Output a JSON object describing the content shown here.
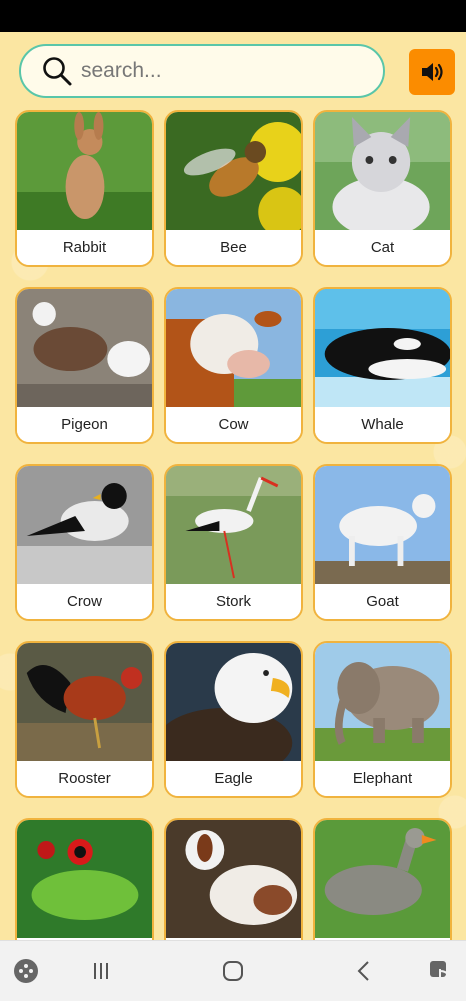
{
  "search": {
    "placeholder": "search..."
  },
  "colors": {
    "accent": "#59c6a9",
    "sound_button": "#fb8c00",
    "card_border": "#f0b33e",
    "background": "#fbe6a2"
  },
  "icons": {
    "search": "search-icon",
    "sound": "speaker-icon",
    "nav": [
      "game-controller-icon",
      "recent-apps-icon",
      "home-icon",
      "back-icon",
      "touch-icon"
    ]
  },
  "animals": [
    {
      "name": "Rabbit"
    },
    {
      "name": "Bee"
    },
    {
      "name": "Cat"
    },
    {
      "name": "Pigeon"
    },
    {
      "name": "Cow"
    },
    {
      "name": "Whale"
    },
    {
      "name": "Crow"
    },
    {
      "name": "Stork"
    },
    {
      "name": "Goat"
    },
    {
      "name": "Rooster"
    },
    {
      "name": "Eagle"
    },
    {
      "name": "Elephant"
    },
    {
      "name": ""
    },
    {
      "name": ""
    },
    {
      "name": ""
    }
  ]
}
